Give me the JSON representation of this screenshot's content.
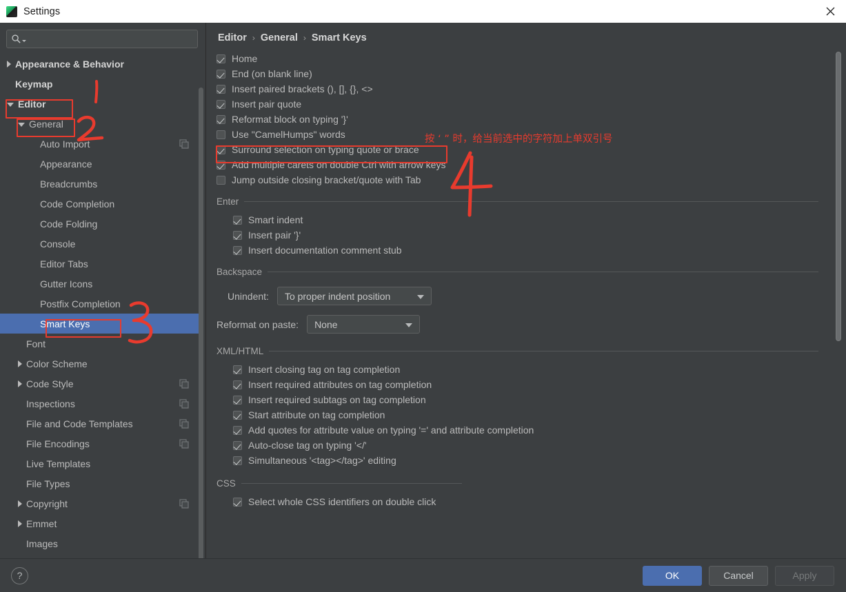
{
  "window": {
    "title": "Settings",
    "app_icon": "intellij-idea-icon",
    "close_icon": "close-icon"
  },
  "sidebar": {
    "search": {
      "placeholder": "",
      "value": "",
      "icon": "search-icon"
    },
    "items": [
      {
        "label": "Appearance & Behavior",
        "indent": 0,
        "arrow": "right",
        "bold": true,
        "selected": false,
        "copy_icon": false
      },
      {
        "label": "Keymap",
        "indent": 0,
        "arrow": "none",
        "bold": true,
        "selected": false,
        "copy_icon": false
      },
      {
        "label": "Editor",
        "indent": 0,
        "arrow": "down",
        "bold": true,
        "selected": false,
        "copy_icon": false
      },
      {
        "label": "General",
        "indent": 1,
        "arrow": "down",
        "bold": false,
        "selected": false,
        "copy_icon": false
      },
      {
        "label": "Auto Import",
        "indent": 2,
        "arrow": "none",
        "bold": false,
        "selected": false,
        "copy_icon": true
      },
      {
        "label": "Appearance",
        "indent": 2,
        "arrow": "none",
        "bold": false,
        "selected": false,
        "copy_icon": false
      },
      {
        "label": "Breadcrumbs",
        "indent": 2,
        "arrow": "none",
        "bold": false,
        "selected": false,
        "copy_icon": false
      },
      {
        "label": "Code Completion",
        "indent": 2,
        "arrow": "none",
        "bold": false,
        "selected": false,
        "copy_icon": false
      },
      {
        "label": "Code Folding",
        "indent": 2,
        "arrow": "none",
        "bold": false,
        "selected": false,
        "copy_icon": false
      },
      {
        "label": "Console",
        "indent": 2,
        "arrow": "none",
        "bold": false,
        "selected": false,
        "copy_icon": false
      },
      {
        "label": "Editor Tabs",
        "indent": 2,
        "arrow": "none",
        "bold": false,
        "selected": false,
        "copy_icon": false
      },
      {
        "label": "Gutter Icons",
        "indent": 2,
        "arrow": "none",
        "bold": false,
        "selected": false,
        "copy_icon": false
      },
      {
        "label": "Postfix Completion",
        "indent": 2,
        "arrow": "none",
        "bold": false,
        "selected": false,
        "copy_icon": false
      },
      {
        "label": "Smart Keys",
        "indent": 2,
        "arrow": "none",
        "bold": false,
        "selected": true,
        "copy_icon": false
      },
      {
        "label": "Font",
        "indent": 1,
        "arrow": "none",
        "bold": false,
        "selected": false,
        "copy_icon": false
      },
      {
        "label": "Color Scheme",
        "indent": 1,
        "arrow": "right",
        "bold": false,
        "selected": false,
        "copy_icon": false
      },
      {
        "label": "Code Style",
        "indent": 1,
        "arrow": "right",
        "bold": false,
        "selected": false,
        "copy_icon": true
      },
      {
        "label": "Inspections",
        "indent": 1,
        "arrow": "none",
        "bold": false,
        "selected": false,
        "copy_icon": true
      },
      {
        "label": "File and Code Templates",
        "indent": 1,
        "arrow": "none",
        "bold": false,
        "selected": false,
        "copy_icon": true
      },
      {
        "label": "File Encodings",
        "indent": 1,
        "arrow": "none",
        "bold": false,
        "selected": false,
        "copy_icon": true
      },
      {
        "label": "Live Templates",
        "indent": 1,
        "arrow": "none",
        "bold": false,
        "selected": false,
        "copy_icon": false
      },
      {
        "label": "File Types",
        "indent": 1,
        "arrow": "none",
        "bold": false,
        "selected": false,
        "copy_icon": false
      },
      {
        "label": "Copyright",
        "indent": 1,
        "arrow": "right",
        "bold": false,
        "selected": false,
        "copy_icon": true
      },
      {
        "label": "Emmet",
        "indent": 1,
        "arrow": "right",
        "bold": false,
        "selected": false,
        "copy_icon": false
      },
      {
        "label": "Images",
        "indent": 1,
        "arrow": "none",
        "bold": false,
        "selected": false,
        "copy_icon": false
      }
    ]
  },
  "breadcrumb": {
    "parts": [
      "Editor",
      "General",
      "Smart Keys"
    ],
    "separator": "›"
  },
  "main": {
    "top_checkboxes": [
      {
        "label": "Home",
        "checked": true
      },
      {
        "label": "End (on blank line)",
        "checked": true
      },
      {
        "label": "Insert paired brackets (), [], {}, <>",
        "checked": true
      },
      {
        "label": "Insert pair quote",
        "checked": true
      },
      {
        "label": "Reformat block on typing '}'",
        "checked": true
      },
      {
        "label": "Use \"CamelHumps\" words",
        "checked": false
      },
      {
        "label": "Surround selection on typing quote or brace",
        "checked": true
      },
      {
        "label": "Add multiple carets on double Ctrl with arrow keys",
        "checked": true
      },
      {
        "label": "Jump outside closing bracket/quote with Tab",
        "checked": false
      }
    ],
    "enter": {
      "title": "Enter",
      "checkboxes": [
        {
          "label": "Smart indent",
          "checked": true
        },
        {
          "label": "Insert pair '}'",
          "checked": true
        },
        {
          "label": "Insert documentation comment stub",
          "checked": true
        }
      ]
    },
    "backspace": {
      "title": "Backspace",
      "unindent_label": "Unindent:",
      "unindent_value": "To proper indent position",
      "reformat_label": "Reformat on paste:",
      "reformat_value": "None"
    },
    "xml_html": {
      "title": "XML/HTML",
      "checkboxes": [
        {
          "label": "Insert closing tag on tag completion",
          "checked": true
        },
        {
          "label": "Insert required attributes on tag completion",
          "checked": true
        },
        {
          "label": "Insert required subtags on tag completion",
          "checked": true
        },
        {
          "label": "Start attribute on tag completion",
          "checked": true
        },
        {
          "label": "Add quotes for attribute value on typing '=' and attribute completion",
          "checked": true
        },
        {
          "label": "Auto-close tag on typing '</'",
          "checked": true
        },
        {
          "label": "Simultaneous '<tag></tag>' editing",
          "checked": true
        }
      ]
    },
    "css": {
      "title": "CSS",
      "checkboxes": [
        {
          "label": "Select whole CSS identifiers on double click",
          "checked": true
        }
      ]
    }
  },
  "footer": {
    "help_label": "?",
    "ok_label": "OK",
    "cancel_label": "Cancel",
    "apply_label": "Apply"
  },
  "annotations": {
    "color": "#e83b2e",
    "note_text": "按 ‘ ” 时，给当前选中的字符加上单双引号",
    "markers": [
      "1",
      "2",
      "3",
      "4"
    ]
  }
}
